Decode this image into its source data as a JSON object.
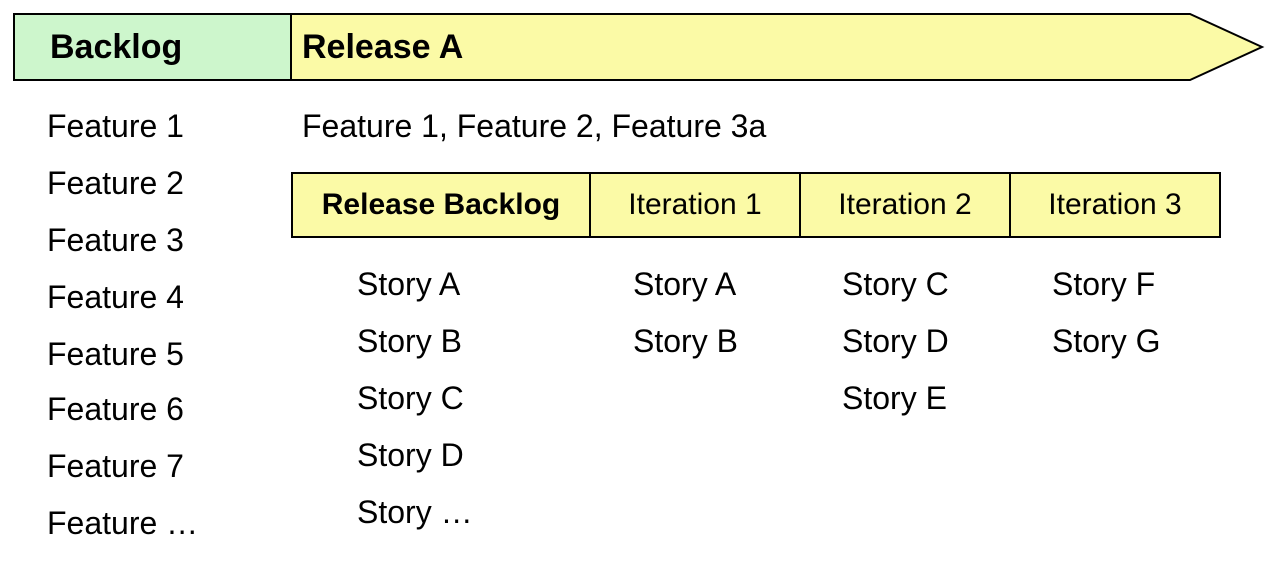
{
  "header": {
    "backlog_label": "Backlog",
    "release_label": "Release A",
    "colors": {
      "backlog_fill": "#cdf6cc",
      "release_fill": "#fbfaa6",
      "outline": "#000000"
    }
  },
  "backlog": {
    "features": [
      "Feature 1",
      "Feature 2",
      "Feature 3",
      "Feature 4",
      "Feature 5",
      "Feature 6",
      "Feature 7",
      "Feature …"
    ]
  },
  "release": {
    "features_text": "Feature 1, Feature 2, Feature 3a",
    "columns": [
      {
        "label": "Release Backlog",
        "bold": true,
        "stories": [
          "Story A",
          "Story B",
          "Story C",
          "Story D",
          "Story …"
        ]
      },
      {
        "label": "Iteration 1",
        "bold": false,
        "stories": [
          "Story A",
          "Story B"
        ]
      },
      {
        "label": "Iteration 2",
        "bold": false,
        "stories": [
          "Story C",
          "Story D",
          "Story E"
        ]
      },
      {
        "label": "Iteration 3",
        "bold": false,
        "stories": [
          "Story F",
          "Story G"
        ]
      }
    ]
  }
}
